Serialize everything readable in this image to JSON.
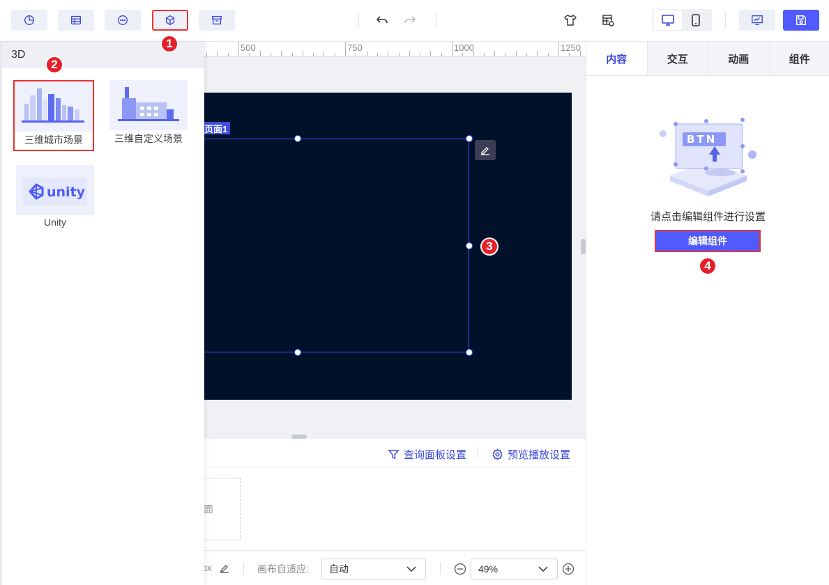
{
  "toolbar": {
    "icons": [
      "chart-icon",
      "table-icon",
      "more-icon",
      "3d-cube-icon",
      "archive-icon",
      "undo-icon",
      "redo-icon",
      "theme-icon",
      "table-settings-icon",
      "desktop-icon",
      "mobile-icon",
      "preview-icon",
      "save-icon"
    ],
    "accent": "#4f5bff"
  },
  "badges": {
    "b1": "1",
    "b2": "2",
    "b3": "3",
    "b4": "4"
  },
  "left_panel": {
    "title": "3D",
    "items": [
      {
        "label": "三维城市场景"
      },
      {
        "label": "三维自定义场景"
      },
      {
        "label": "Unity",
        "logo_text": "unity"
      }
    ]
  },
  "ruler": {
    "labels": [
      "500",
      "750",
      "1000",
      "1250"
    ]
  },
  "canvas": {
    "page_tag": "页面1",
    "background": "#011129"
  },
  "bottom_panel": {
    "query_panel": "查询面板设置",
    "preview_play": "预览播放设置",
    "page_thumb_text": "面"
  },
  "statusbar": {
    "partial_unit": "px",
    "fit_label": "画布自适应:",
    "fit_value": "自动",
    "zoom_value": "49%"
  },
  "right_panel": {
    "tabs": [
      "内容",
      "交互",
      "动画",
      "组件"
    ],
    "active_tab": "内容",
    "art_text": "BTN",
    "hint": "请点击编辑组件进行设置",
    "edit_button": "编辑组件"
  }
}
